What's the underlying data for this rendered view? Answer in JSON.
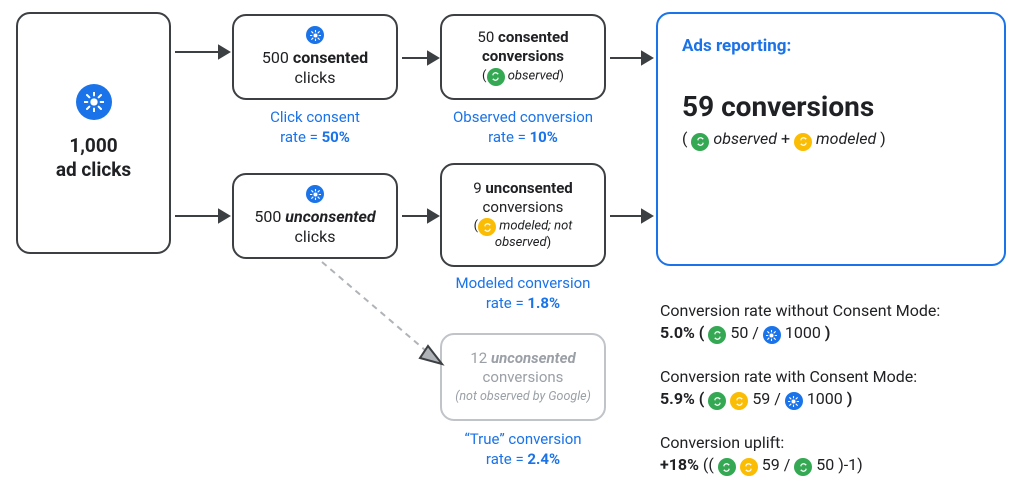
{
  "flow": {
    "source": {
      "count": "1,000",
      "label": "ad clicks"
    },
    "consented_clicks": {
      "count": "500",
      "word": "consented",
      "label": "clicks"
    },
    "unconsented_clicks": {
      "count": "500",
      "word": "unconsented",
      "label": "clicks"
    },
    "consented_conv": {
      "count": "50",
      "word": "consented",
      "label": "conversions",
      "note": "observed"
    },
    "unconsented_conv": {
      "count": "9",
      "word": "unconsented",
      "label": "conversions",
      "note": "modeled; not observed"
    },
    "true_conv": {
      "count": "12",
      "word": "unconsented",
      "label": "conversions",
      "note": "(not observed by Google)"
    }
  },
  "rates": {
    "click_consent": {
      "l1": "Click consent",
      "l2": "rate = ",
      "val": "50%"
    },
    "observed_conv": {
      "l1": "Observed conversion",
      "l2": "rate = ",
      "val": "10%"
    },
    "modeled_conv": {
      "l1": "Modeled conversion",
      "l2": "rate = ",
      "val": "1.8%"
    },
    "true_conv": {
      "l1": "“True” conversion",
      "l2": "rate = ",
      "val": "2.4%"
    }
  },
  "result": {
    "heading": "Ads reporting:",
    "count_text": "59 conversions",
    "lp": "(",
    "obs": "observed",
    "plus": " + ",
    "mod": "modeled",
    "rp": ")"
  },
  "stats": {
    "without": {
      "t": "Conversion rate without Consent Mode:",
      "pct": "5.0%",
      "lp": " ( ",
      "n1": "50",
      "slash": " / ",
      "n2": "1000",
      "rp": ")"
    },
    "with": {
      "t": "Conversion rate with Consent Mode:",
      "pct": "5.9%",
      "lp": " ( ",
      "n1": "59",
      "slash": " / ",
      "n2": "1000",
      "rp": ")"
    },
    "uplift": {
      "t": "Conversion uplift:",
      "pct": "+18%",
      "lp": " (( ",
      "n1": "59",
      "slash": " / ",
      "n2": "50",
      "rp": ")-1)"
    }
  }
}
